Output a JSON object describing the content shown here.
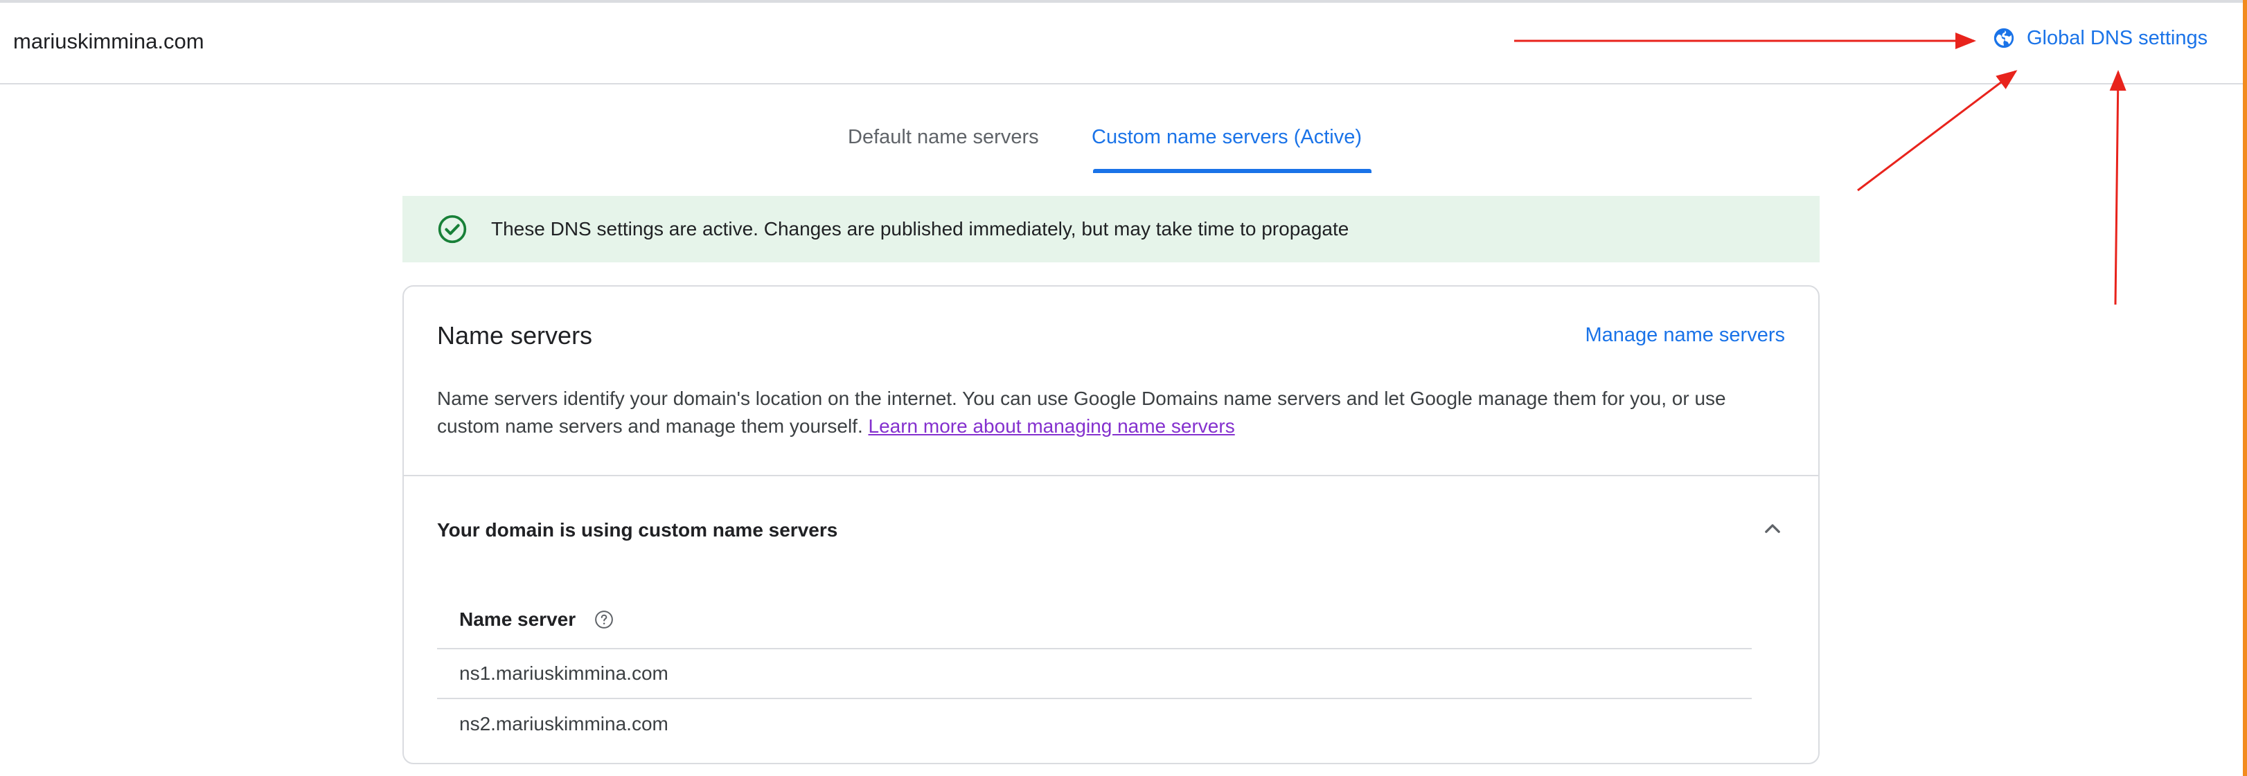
{
  "header": {
    "domain": "mariuskimmina.com",
    "global_dns_label": "Global DNS settings",
    "global_dns_icon": "globe-icon"
  },
  "tabs": [
    {
      "label": "Default name servers",
      "active": false
    },
    {
      "label": "Custom name servers (Active)",
      "active": true
    }
  ],
  "banner": {
    "icon": "check-circle-icon",
    "message": "These DNS settings are active. Changes are published immediately, but may take time to propagate"
  },
  "card": {
    "title": "Name servers",
    "manage_label": "Manage name servers",
    "description": "Name servers identify your domain's location on the internet. You can use Google Domains name servers and let Google manage them for you, or use custom name servers and manage them yourself.",
    "learn_more_label": "Learn more about managing name servers",
    "section_title": "Your domain is using custom name servers",
    "table": {
      "column_header": "Name server",
      "rows": [
        "ns1.mariuskimmina.com",
        "ns2.mariuskimmina.com"
      ]
    }
  },
  "colors": {
    "accent": "#1a73e8",
    "banner_bg": "#e6f4ea",
    "success": "#188038",
    "link_visited": "#8430ce",
    "annotation_arrow": "#e8231c"
  }
}
